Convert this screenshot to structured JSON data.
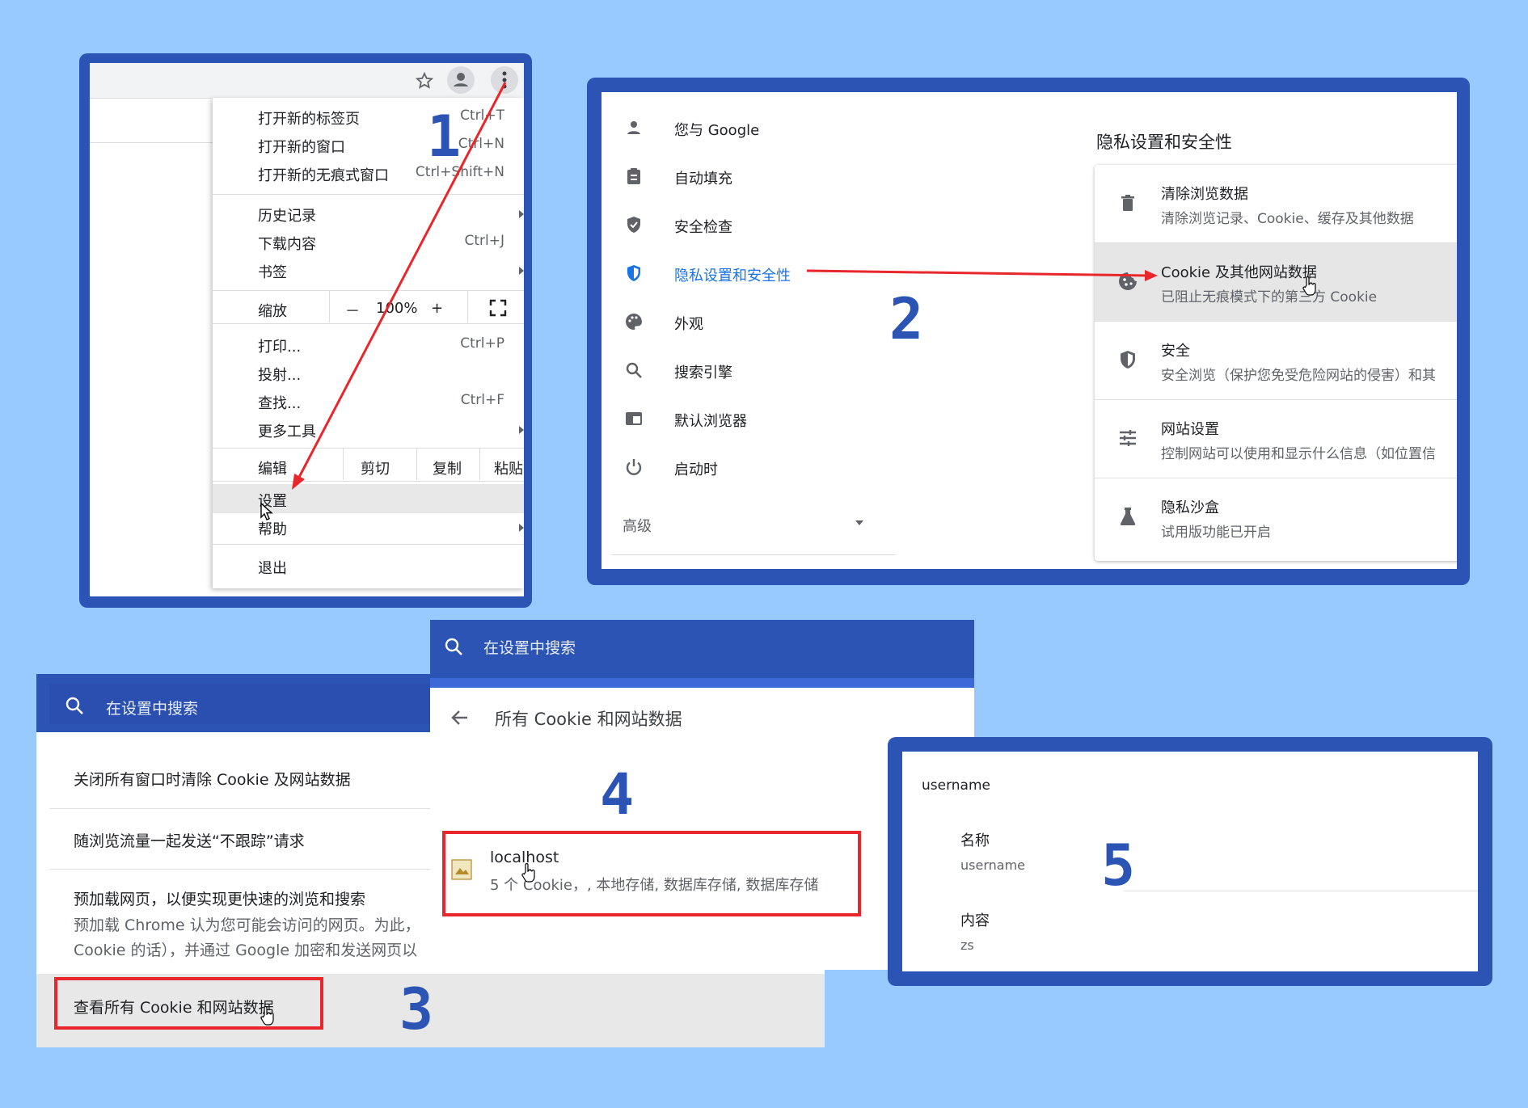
{
  "step_numbers": [
    "1",
    "2",
    "3",
    "4",
    "5"
  ],
  "colors": {
    "background": "#99caff",
    "frame": "#2c54b4",
    "highlight_red": "#e8262b",
    "link_blue": "#1a73e8"
  },
  "panel1": {
    "icons": [
      "star-icon",
      "profile-icon",
      "more-vert-icon"
    ],
    "menu": {
      "new_tab": "打开新的标签页",
      "new_tab_sc": "Ctrl+T",
      "new_window": "打开新的窗口",
      "new_window_sc": "Ctrl+N",
      "incognito": "打开新的无痕式窗口",
      "incognito_sc": "Ctrl+Shift+N",
      "history": "历史记录",
      "downloads": "下载内容",
      "downloads_sc": "Ctrl+J",
      "bookmarks": "书签",
      "zoom": "缩放",
      "zoom_minus": "－",
      "zoom_value": "100%",
      "zoom_plus": "+",
      "print": "打印...",
      "print_sc": "Ctrl+P",
      "cast": "投射...",
      "find": "查找...",
      "find_sc": "Ctrl+F",
      "more_tools": "更多工具",
      "edit": "编辑",
      "cut": "剪切",
      "copy": "复制",
      "paste": "粘贴",
      "settings": "设置",
      "help": "帮助",
      "exit": "退出"
    }
  },
  "panel2": {
    "nav": [
      {
        "label": "您与 Google",
        "icon": "person-icon"
      },
      {
        "label": "自动填充",
        "icon": "clipboard-icon"
      },
      {
        "label": "安全检查",
        "icon": "shield-check-icon"
      },
      {
        "label": "隐私设置和安全性",
        "icon": "shield-icon"
      },
      {
        "label": "外观",
        "icon": "palette-icon"
      },
      {
        "label": "搜索引擎",
        "icon": "search-icon"
      },
      {
        "label": "默认浏览器",
        "icon": "browser-icon"
      },
      {
        "label": "启动时",
        "icon": "power-icon"
      }
    ],
    "advanced": "高级",
    "section_title": "隐私设置和安全性",
    "rows": [
      {
        "title": "清除浏览数据",
        "sub": "清除浏览记录、Cookie、缓存及其他数据",
        "icon": "trash-icon"
      },
      {
        "title": "Cookie 及其他网站数据",
        "sub": "已阻止无痕模式下的第三方 Cookie",
        "icon": "cookie-icon"
      },
      {
        "title": "安全",
        "sub": "安全浏览（保护您免受危险网站的侵害）和其",
        "icon": "shield-icon"
      },
      {
        "title": "网站设置",
        "sub": "控制网站可以使用和显示什么信息（如位置信",
        "icon": "tune-icon"
      },
      {
        "title": "隐私沙盒",
        "sub": "试用版功能已开启",
        "icon": "flask-icon"
      }
    ]
  },
  "panel3": {
    "search_placeholder": "在设置中搜索",
    "items": {
      "clear_on_exit": "关闭所有窗口时清除 Cookie 及网站数据",
      "do_not_track": "随浏览流量一起发送“不跟踪”请求",
      "preload_title": "预加载网页，以便实现更快速的浏览和搜索",
      "preload_sub1": "预加载 Chrome 认为您可能会访问的网页。为此，",
      "preload_sub2": "Cookie 的话），并通过 Google 加密和发送网页以",
      "see_all": "查看所有 Cookie 和网站数据"
    }
  },
  "panel4": {
    "search_placeholder": "在设置中搜索",
    "page_title": "所有 Cookie 和网站数据",
    "site": {
      "name": "localhost",
      "detail": "5 个 Cookie，, 本地存储, 数据库存储, 数据库存储"
    }
  },
  "panel5": {
    "cookie_name": "username",
    "name_label": "名称",
    "name_value": "username",
    "content_label": "内容",
    "content_value": "zs"
  }
}
